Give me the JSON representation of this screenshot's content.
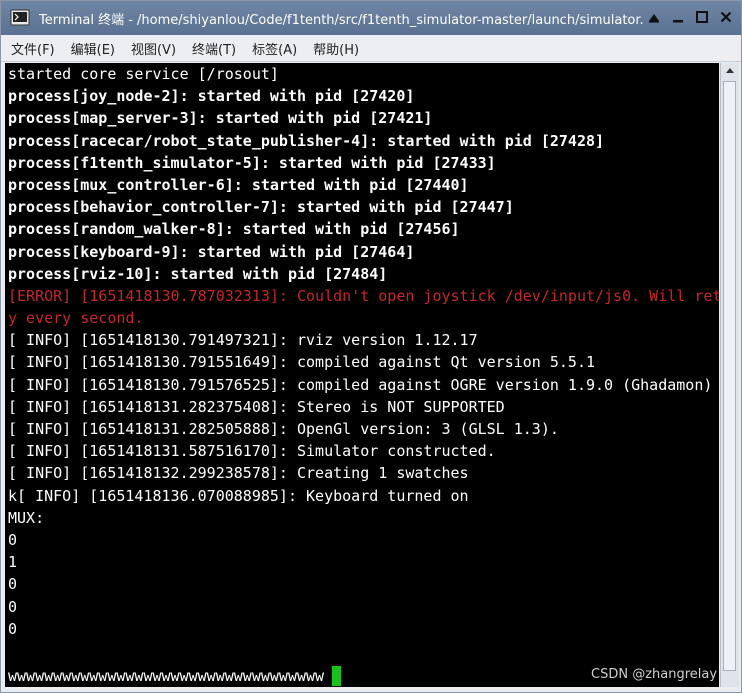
{
  "window": {
    "title": "Terminal 终端 - /home/shiyanlou/Code/f1tenth/src/f1tenth_simulator-master/launch/simulator.",
    "controls": [
      "⏶",
      "☐",
      "✕"
    ]
  },
  "menu": [
    {
      "label": "文件(F)"
    },
    {
      "label": "编辑(E)"
    },
    {
      "label": "视图(V)"
    },
    {
      "label": "终端(T)"
    },
    {
      "label": "标签(A)"
    },
    {
      "label": "帮助(H)"
    }
  ],
  "terminal": {
    "lines": [
      {
        "text": "started core service [/rosout]",
        "style": "normal"
      },
      {
        "text": "process[joy_node-2]: started with pid [27420]",
        "style": "bold"
      },
      {
        "text": "process[map_server-3]: started with pid [27421]",
        "style": "bold"
      },
      {
        "text": "process[racecar/robot_state_publisher-4]: started with pid [27428]",
        "style": "bold"
      },
      {
        "text": "process[f1tenth_simulator-5]: started with pid [27433]",
        "style": "bold"
      },
      {
        "text": "process[mux_controller-6]: started with pid [27440]",
        "style": "bold"
      },
      {
        "text": "process[behavior_controller-7]: started with pid [27447]",
        "style": "bold"
      },
      {
        "text": "process[random_walker-8]: started with pid [27456]",
        "style": "bold"
      },
      {
        "text": "process[keyboard-9]: started with pid [27464]",
        "style": "bold"
      },
      {
        "text": "process[rviz-10]: started with pid [27484]",
        "style": "bold"
      },
      {
        "text": "[ERROR] [1651418130.787032313]: Couldn't open joystick /dev/input/js0. Will retr",
        "style": "err"
      },
      {
        "text": "y every second.",
        "style": "err"
      },
      {
        "text": "[ INFO] [1651418130.791497321]: rviz version 1.12.17",
        "style": "normal"
      },
      {
        "text": "[ INFO] [1651418130.791551649]: compiled against Qt version 5.5.1",
        "style": "normal"
      },
      {
        "text": "[ INFO] [1651418130.791576525]: compiled against OGRE version 1.9.0 (Ghadamon)",
        "style": "normal"
      },
      {
        "text": "[ INFO] [1651418131.282375408]: Stereo is NOT SUPPORTED",
        "style": "normal"
      },
      {
        "text": "[ INFO] [1651418131.282505888]: OpenGl version: 3 (GLSL 1.3).",
        "style": "normal"
      },
      {
        "text": "[ INFO] [1651418131.587516170]: Simulator constructed.",
        "style": "normal"
      },
      {
        "text": "[ INFO] [1651418132.299238578]: Creating 1 swatches",
        "style": "normal"
      },
      {
        "text": "k[ INFO] [1651418136.070088985]: Keyboard turned on",
        "style": "normal"
      },
      {
        "text": "MUX:",
        "style": "normal"
      },
      {
        "text": "0",
        "style": "normal"
      },
      {
        "text": "1",
        "style": "normal"
      },
      {
        "text": "0",
        "style": "normal"
      },
      {
        "text": "0",
        "style": "normal"
      },
      {
        "text": "0",
        "style": "normal"
      }
    ],
    "input_line": "wwwwwwwwwwwwwwwwwwwwwwwwwwwwwwwwwww",
    "cursor_color": "#18c21a",
    "error_color": "#c4262a"
  },
  "watermark": "CSDN @zhangrelay"
}
